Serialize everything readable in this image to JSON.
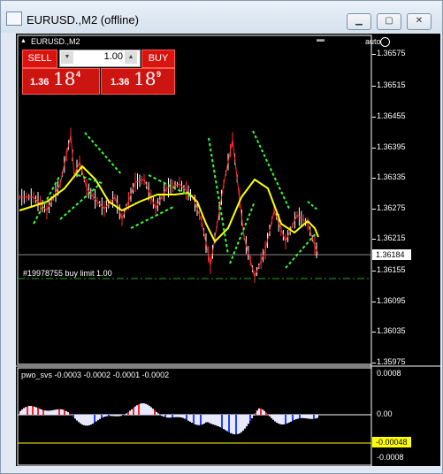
{
  "window": {
    "title": "EURUSD.,M2 (offline)",
    "icon": "chart-window-icon",
    "controls": {
      "minimize": "▁",
      "maximize": "▢",
      "close": "✕"
    }
  },
  "chart": {
    "symbol_label": "EURUSD.,M2",
    "auto_label": "auto",
    "trade_panel": {
      "sell_label": "SELL",
      "buy_label": "BUY",
      "lot_value": "1.00",
      "lot_down": "▼",
      "lot_up": "▲",
      "sell_price": {
        "prefix": "1.36",
        "big": "18",
        "sup": "4"
      },
      "buy_price": {
        "prefix": "1.36",
        "big": "18",
        "sup": "9"
      }
    },
    "price_axis_ticks": [
      "1.36575",
      "1.36515",
      "1.36455",
      "1.36395",
      "1.36335",
      "1.36275",
      "1.36215",
      "1.36155",
      "1.36095",
      "1.36035",
      "1.35975"
    ],
    "current_price": "1.36184",
    "order_line_label": "#19978755 buy limit 1.00",
    "indicator": {
      "label": "pwo_svs -0.0003 -0.0002 -0.0001 -0.0002",
      "axis_ticks": [
        "0.0008",
        "0.00",
        "-0.0008"
      ],
      "current_value": "-0.00048"
    },
    "colors": {
      "background": "#000000",
      "candles": "#ffffff",
      "price_line": "#ff2a2a",
      "moving_average": "#ffff00",
      "bands": "#33ff33",
      "order_line": "#22aa22",
      "trade_buttons": "#d9140f"
    }
  }
}
